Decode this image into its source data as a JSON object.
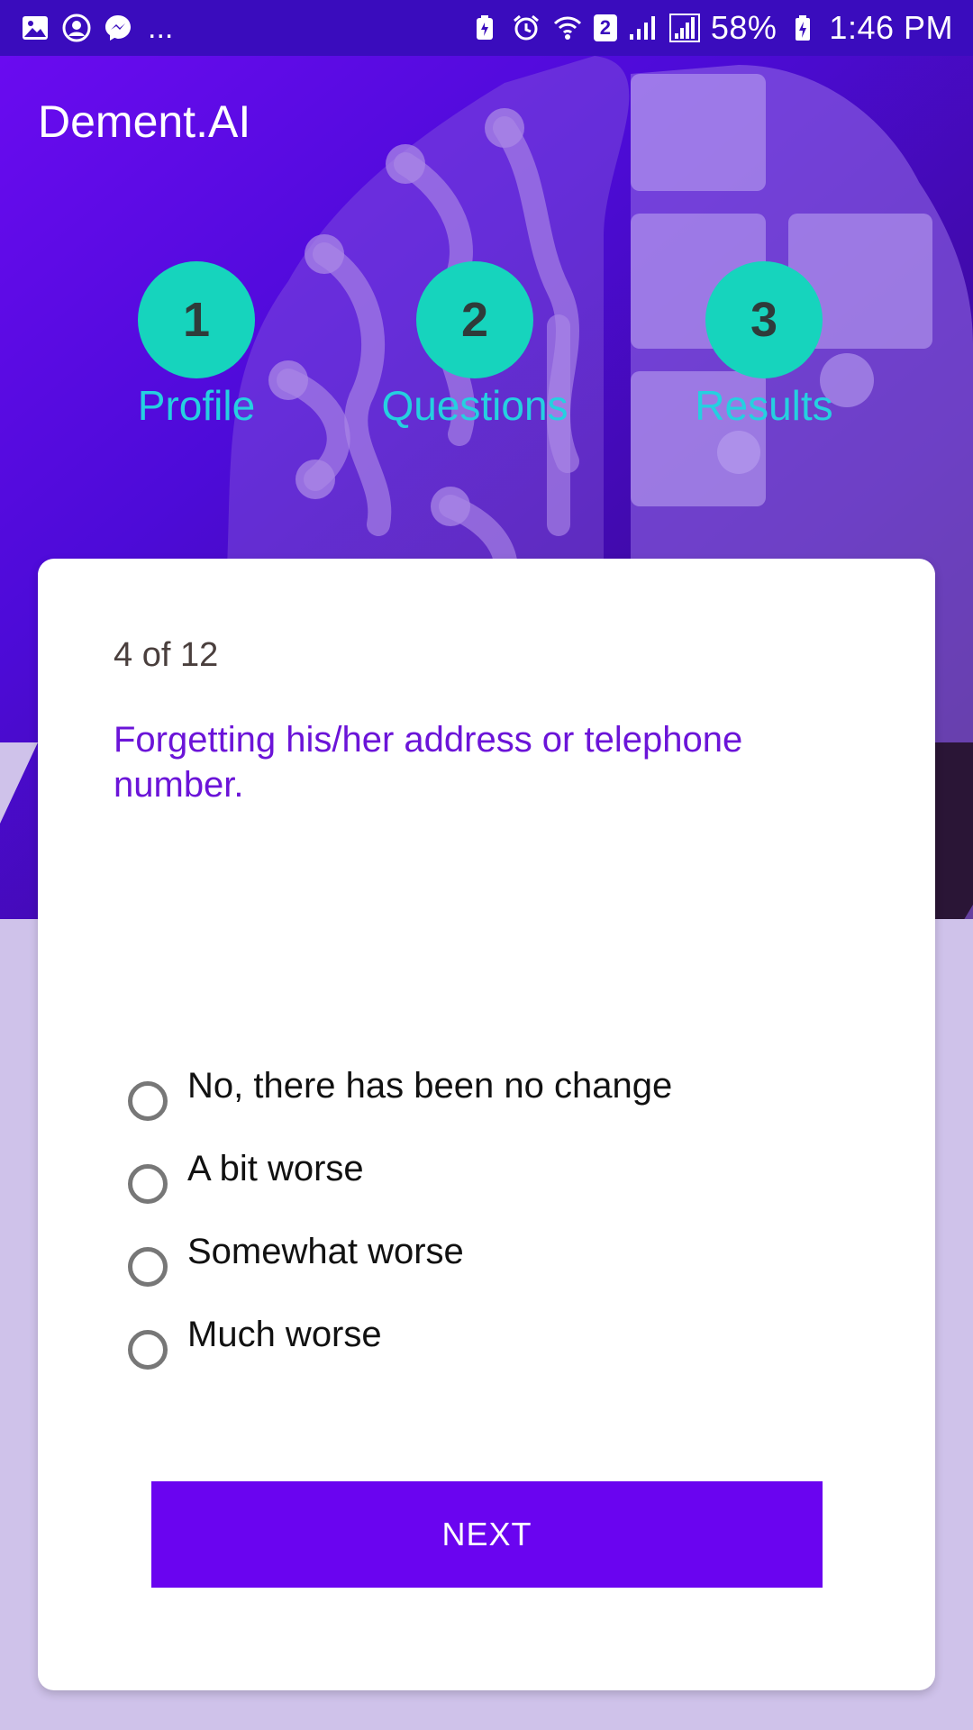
{
  "status_bar": {
    "battery": "58%",
    "time": "1:46 PM",
    "sim_label": "2",
    "left_icons": [
      "gallery-icon",
      "account-icon",
      "messenger-icon"
    ],
    "more": "...",
    "right_icons": [
      "battery-saver-icon",
      "alarm-icon",
      "wifi-icon",
      "sim-icon",
      "signal-icon",
      "signal-icon",
      "charging-icon"
    ]
  },
  "app": {
    "title": "Dement.AI"
  },
  "steps": [
    {
      "number": "1",
      "label": "Profile"
    },
    {
      "number": "2",
      "label": "Questions"
    },
    {
      "number": "3",
      "label": "Results"
    }
  ],
  "question_card": {
    "progress": "4 of 12",
    "question": "Forgetting his/her address or telephone number.",
    "options": [
      "No, there has been no change",
      "A bit worse",
      "Somewhat worse",
      "Much worse"
    ],
    "next_label": "NEXT"
  },
  "colors": {
    "status_bar": "#3a0cbd",
    "header_gradient_start": "#6a0bf0",
    "step_circle": "#16d4bd",
    "step_label": "#25d0e0",
    "question_text": "#6b14d8",
    "next_button": "#6a04f0",
    "page_background": "#cfc2ea"
  }
}
